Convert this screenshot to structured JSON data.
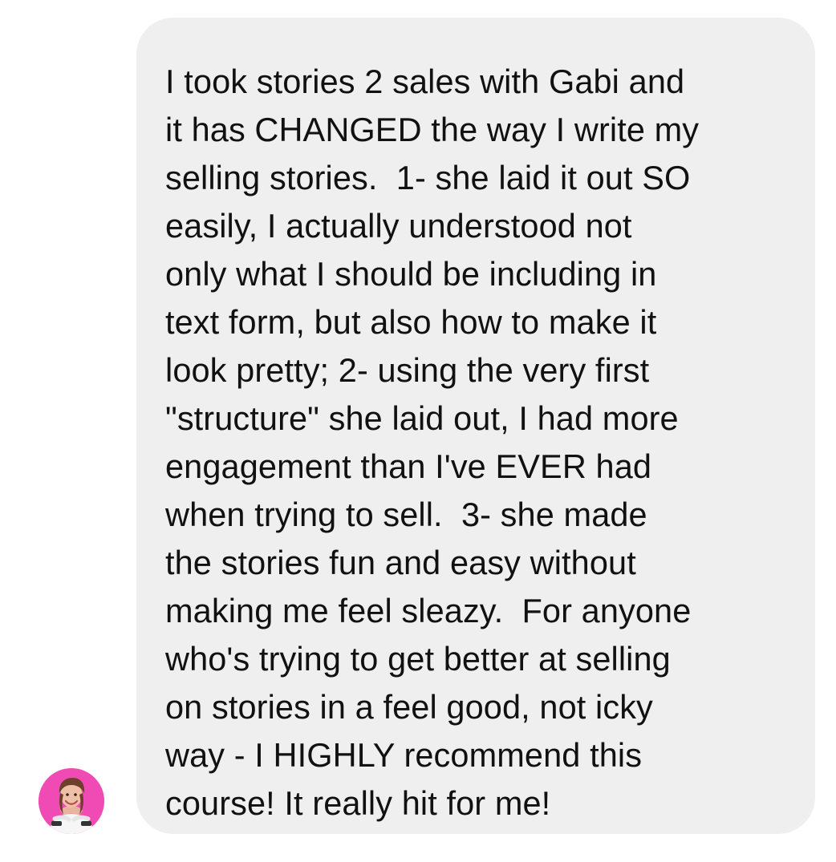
{
  "message": {
    "lines": [
      "I took stories 2 sales with Gabi and",
      "it has CHANGED the way I write my",
      "selling stories.  1- she laid it out SO",
      "easily, I actually understood not",
      "only what I should be including in",
      "text form, but also how to make it",
      "look pretty; 2- using the very first",
      "\"structure\" she laid out, I had more",
      "engagement than I've EVER had",
      "when trying to sell.  3- she made",
      "the stories fun and easy without",
      "making me feel sleazy.  For anyone",
      "who's trying to get better at selling",
      "on stories in a feel good, not icky",
      "way - I HIGHLY recommend this",
      "course! It really hit for me!"
    ]
  },
  "colors": {
    "bubble_background": "#efefef",
    "text": "#111111",
    "avatar_background": "#f04bb4"
  },
  "icons": {
    "avatar": "profile-photo"
  }
}
